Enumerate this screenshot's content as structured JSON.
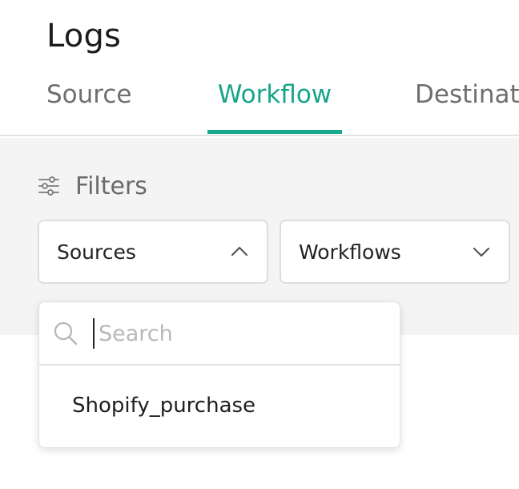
{
  "header": {
    "title": "Logs"
  },
  "tabs": [
    {
      "label": "Source",
      "active": false
    },
    {
      "label": "Workflow",
      "active": true
    },
    {
      "label": "Destinat",
      "active": false
    }
  ],
  "colors": {
    "accent": "#14a589",
    "panel_bg": "#f4f4f4",
    "muted_text": "#6e6e6e"
  },
  "filters": {
    "label": "Filters",
    "icon": "sliders-icon",
    "sources_select": {
      "value": "Sources",
      "open": true,
      "icon": "chevron-up-icon"
    },
    "workflows_select": {
      "value": "Workflows",
      "open": false,
      "icon": "chevron-down-icon"
    }
  },
  "dropdown": {
    "search": {
      "placeholder": "Search",
      "value": "",
      "icon": "search-icon"
    },
    "options": [
      "Shopify_purchase"
    ]
  }
}
